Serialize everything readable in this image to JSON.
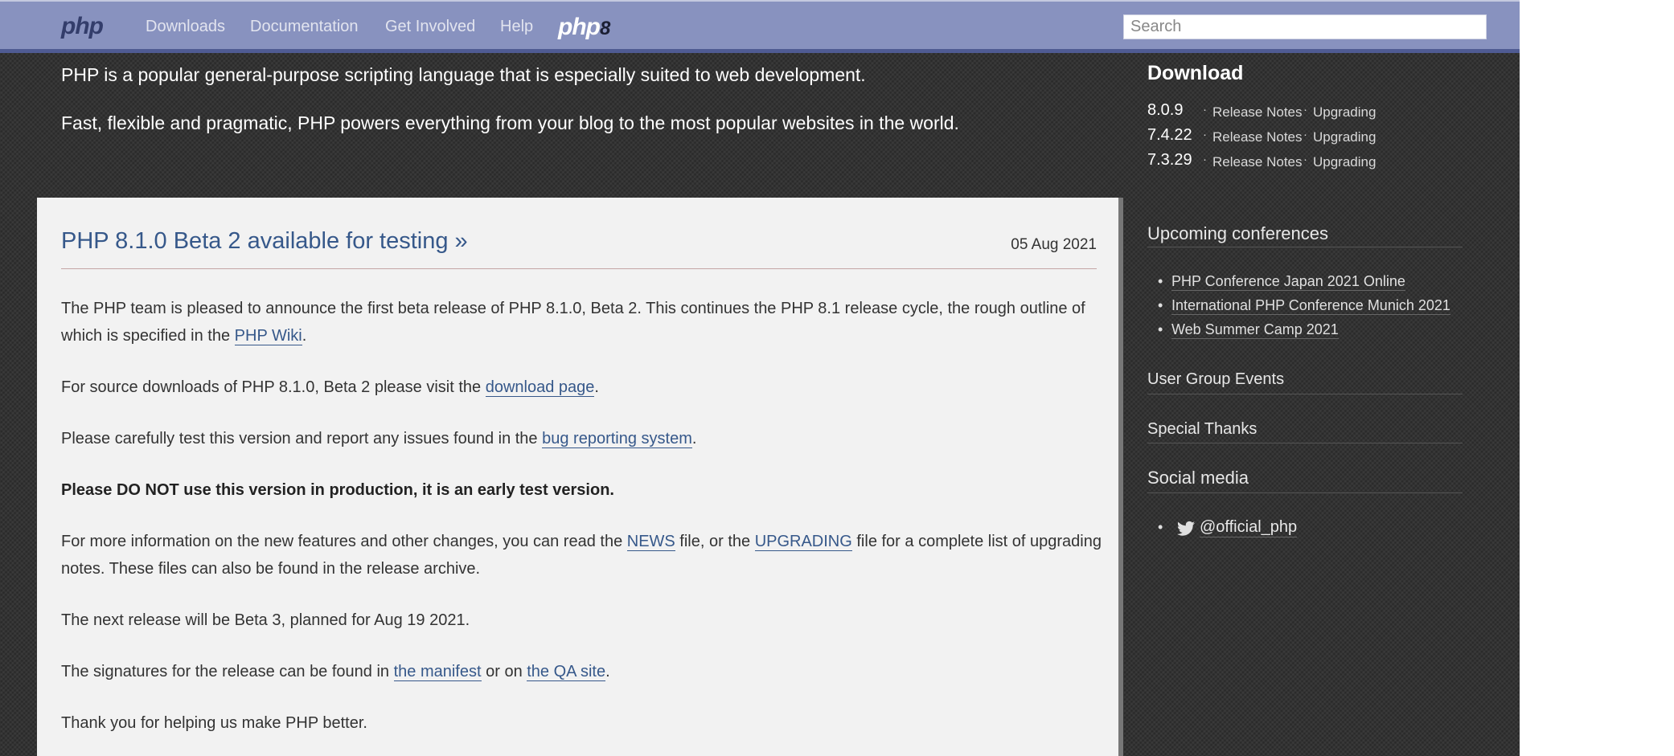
{
  "nav": {
    "logo": "php",
    "links": [
      "Downloads",
      "Documentation",
      "Get Involved",
      "Help"
    ],
    "php8_logo": "php",
    "php8_mark": "8",
    "search_placeholder": "Search"
  },
  "intro": {
    "line1": "PHP is a popular general-purpose scripting language that is especially suited to web development.",
    "line2": "Fast, flexible and pragmatic, PHP powers everything from your blog to the most popular websites in the world."
  },
  "article": {
    "title": "PHP 8.1.0 Beta 2 available for testing »",
    "date": "05 Aug 2021",
    "p1_pre": "The PHP team is pleased to announce the first beta release of PHP 8.1.0, Beta 2. This continues the PHP 8.1 release cycle, the rough outline of which is specified in the ",
    "p1_link": "PHP Wiki",
    "p1_post": ".",
    "p2_pre": "For source downloads of PHP 8.1.0, Beta 2 please visit the ",
    "p2_link": "download page",
    "p2_post": ".",
    "p3_pre": "Please carefully test this version and report any issues found in the ",
    "p3_link": "bug reporting system",
    "p3_post": ".",
    "p4_bold": "Please DO NOT use this version in production, it is an early test version.",
    "p5_pre": "For more information on the new features and other changes, you can read the ",
    "p5_link1": "NEWS",
    "p5_mid": " file, or the ",
    "p5_link2": "UPGRADING",
    "p5_post": " file for a complete list of upgrading notes. These files can also be found in the release archive.",
    "p6": "The next release will be Beta 3, planned for Aug 19 2021.",
    "p7_pre": "The signatures for the release can be found in ",
    "p7_link1": "the manifest",
    "p7_mid": " or on ",
    "p7_link2": "the QA site",
    "p7_post": ".",
    "p8": "Thank you for helping us make PHP better."
  },
  "sidebar": {
    "download_title": "Download",
    "downloads": [
      {
        "version": "8.0.9",
        "notes": "Release Notes",
        "upgrading": "Upgrading",
        "dot": "·"
      },
      {
        "version": "7.4.22",
        "notes": "Release Notes",
        "upgrading": "Upgrading",
        "dot": "·"
      },
      {
        "version": "7.3.29",
        "notes": "Release Notes",
        "upgrading": "Upgrading",
        "dot": "·"
      }
    ],
    "conferences_title": "Upcoming conferences",
    "conferences": [
      "PHP Conference Japan 2021 Online",
      "International PHP Conference Munich 2021",
      "Web Summer Camp 2021"
    ],
    "user_group_events": "User Group Events",
    "special_thanks": "Special Thanks",
    "social_title": "Social media",
    "twitter_handle": "@official_php",
    "bullet": "•"
  }
}
